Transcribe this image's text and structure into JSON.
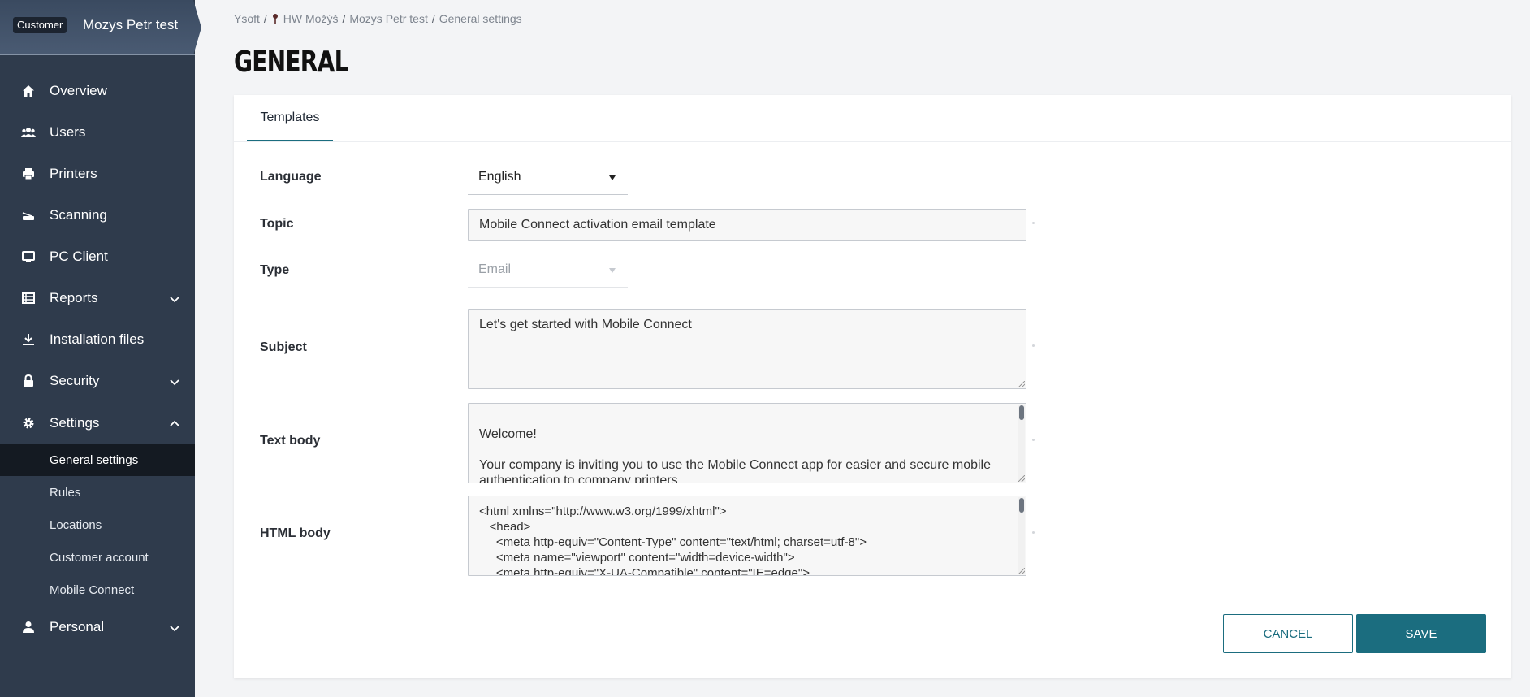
{
  "customer": {
    "badge": "Customer",
    "name": "Mozys Petr test"
  },
  "sidebar": {
    "items": [
      {
        "label": "Overview",
        "icon": "home-icon"
      },
      {
        "label": "Users",
        "icon": "users-icon"
      },
      {
        "label": "Printers",
        "icon": "printer-icon"
      },
      {
        "label": "Scanning",
        "icon": "scanner-icon"
      },
      {
        "label": "PC Client",
        "icon": "monitor-icon"
      },
      {
        "label": "Reports",
        "icon": "reports-icon",
        "expandable": true
      },
      {
        "label": "Installation files",
        "icon": "download-icon"
      },
      {
        "label": "Security",
        "icon": "lock-icon",
        "expandable": true
      },
      {
        "label": "Settings",
        "icon": "gear-icon",
        "expanded": true
      },
      {
        "label": "Personal",
        "icon": "person-icon",
        "expandable": true
      }
    ],
    "settings_sub": [
      {
        "label": "General settings",
        "active": true
      },
      {
        "label": "Rules"
      },
      {
        "label": "Locations"
      },
      {
        "label": "Customer account"
      },
      {
        "label": "Mobile Connect"
      }
    ]
  },
  "breadcrumb": {
    "items": [
      "Ysoft",
      "HW Možýš",
      "Mozys Petr test",
      "General settings"
    ],
    "separator": "/"
  },
  "page": {
    "title": "GENERAL"
  },
  "tabs": [
    {
      "label": "Templates",
      "active": true
    }
  ],
  "form": {
    "language": {
      "label": "Language",
      "value": "English"
    },
    "topic": {
      "label": "Topic",
      "value": "Mobile Connect activation email template"
    },
    "type": {
      "label": "Type",
      "value": "Email",
      "disabled": true
    },
    "subject": {
      "label": "Subject",
      "value": "Let's get started with Mobile Connect"
    },
    "text_body": {
      "label": "Text body",
      "value": "\nWelcome!\n\nYour company is inviting you to use the Mobile Connect app for easier and secure mobile\nauthentication to company printers"
    },
    "html_body": {
      "label": "HTML body",
      "value": "<html xmlns=\"http://www.w3.org/1999/xhtml\">\n   <head>\n     <meta http-equiv=\"Content-Type\" content=\"text/html; charset=utf-8\">\n     <meta name=\"viewport\" content=\"width=device-width\">\n     <meta http-equiv=\"X-UA-Compatible\" content=\"IE=edge\">"
    }
  },
  "actions": {
    "cancel_label": "CANCEL",
    "save_label": "SAVE"
  },
  "colors": {
    "sidebar_bg": "#2f3b4c",
    "accent": "#1b6d7f",
    "active_sub_bg": "#141a22"
  }
}
